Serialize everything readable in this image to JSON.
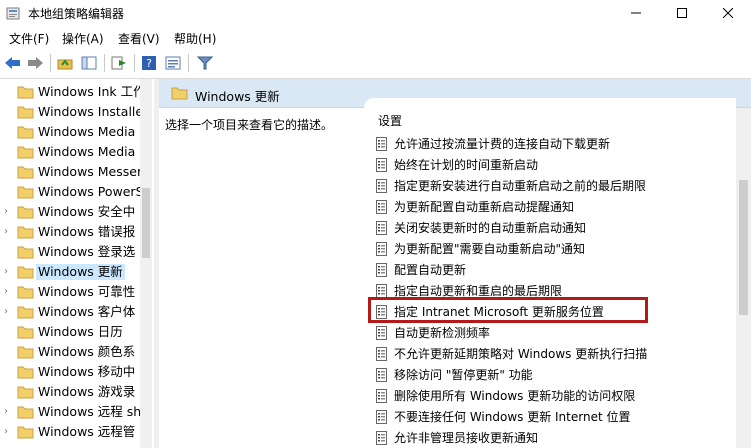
{
  "window": {
    "title": "本地组策略编辑器"
  },
  "menu": [
    "文件(F)",
    "操作(A)",
    "查看(V)",
    "帮助(H)"
  ],
  "toolbar": [
    "back-icon",
    "forward-icon",
    "up-folder-icon",
    "show-tree-icon",
    "export-icon",
    "help-icon",
    "properties-icon",
    "filter-icon"
  ],
  "tree": {
    "items": [
      {
        "label": "Windows Ink 工作"
      },
      {
        "label": "Windows Installe"
      },
      {
        "label": "Windows Media"
      },
      {
        "label": "Windows Media"
      },
      {
        "label": "Windows Messer"
      },
      {
        "label": "Windows PowerS"
      },
      {
        "label": "Windows 安全中"
      },
      {
        "label": "Windows 错误报"
      },
      {
        "label": "Windows 登录选"
      },
      {
        "label": "Windows 更新"
      },
      {
        "label": "Windows 可靠性"
      },
      {
        "label": "Windows 客户体"
      },
      {
        "label": "Windows 日历"
      },
      {
        "label": "Windows 颜色系"
      },
      {
        "label": "Windows 移动中"
      },
      {
        "label": "Windows 游戏录"
      },
      {
        "label": "Windows 远程 sh"
      },
      {
        "label": "Windows 远程管"
      }
    ]
  },
  "header": {
    "title": "Windows 更新"
  },
  "description": {
    "text": "选择一个项目来查看它的描述。"
  },
  "list": {
    "column": "设置",
    "items": [
      "允许通过按流量计费的连接自动下载更新",
      "始终在计划的时间重新启动",
      "指定更新安装进行自动重新启动之前的最后期限",
      "为更新配置自动重新启动提醒通知",
      "关闭安装更新时的自动重新启动通知",
      "为更新配置\"需要自动重新启动\"通知",
      "配置自动更新",
      "指定自动更新和重启的最后期限",
      "指定 Intranet Microsoft 更新服务位置",
      "自动更新检测频率",
      "不允许更新延期策略对 Windows 更新执行扫描",
      "移除访问 \"暂停更新\" 功能",
      "删除使用所有 Windows 更新功能的访问权限",
      "不要连接任何 Windows 更新 Internet 位置",
      "允许非管理员接收更新通知"
    ]
  },
  "colors": {
    "highlight": "#b51a1a",
    "selection": "#cce8ff",
    "header_bg": "#dae8f5"
  }
}
